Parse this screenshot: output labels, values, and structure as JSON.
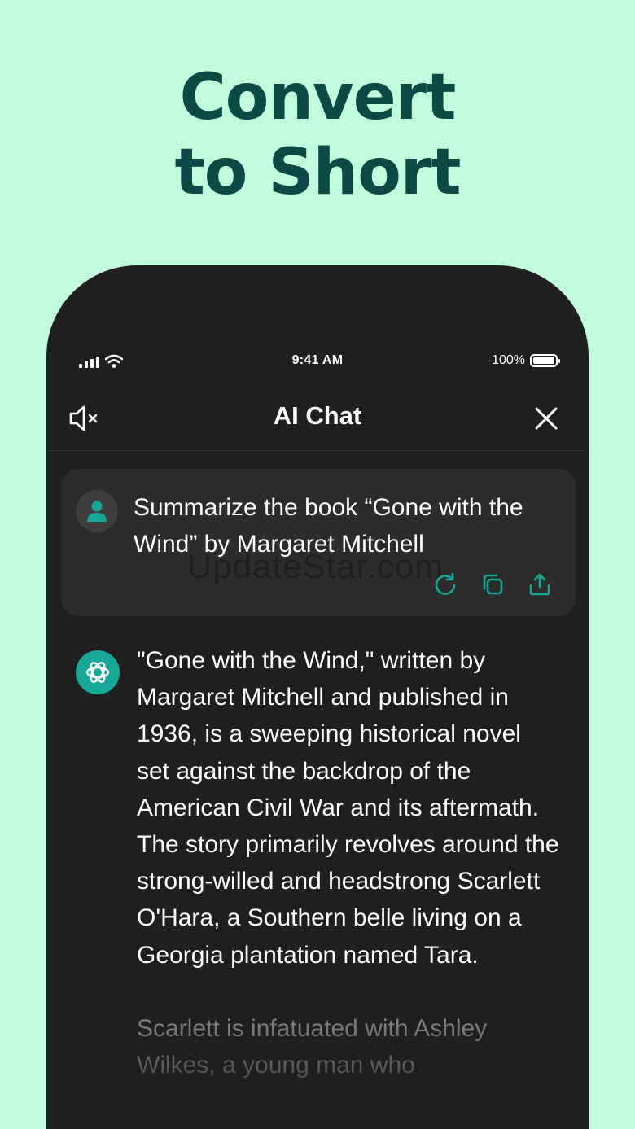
{
  "headline": {
    "line1": "Convert",
    "line2": "to Short"
  },
  "status_bar": {
    "time": "9:41 AM",
    "battery": "100%"
  },
  "nav": {
    "title": "AI Chat"
  },
  "icons": {
    "mute": "speaker-mute-icon",
    "close": "close-icon",
    "user": "user-icon",
    "ai": "openai-logo-icon",
    "regenerate": "refresh-icon",
    "copy": "copy-icon",
    "share": "share-icon"
  },
  "colors": {
    "background": "#c1fcdd",
    "headline": "#0b4a44",
    "accent": "#16a897",
    "phone": "#1f1f1f"
  },
  "user_message": {
    "text": "Summarize the book “Gone with the Wind” by Margaret Mitchell"
  },
  "watermark": "UpdateStar.com",
  "ai_message": {
    "paragraph1": "\"Gone with the Wind,\" written by Margaret Mitchell and published in 1936, is a sweeping historical novel set against the backdrop of the American Civil War and its aftermath. The story primarily revolves around the strong-willed and headstrong Scarlett O'Hara, a Southern belle living on a Georgia plantation named Tara.",
    "paragraph2": "Scarlett is infatuated with Ashley Wilkes, a young man who"
  }
}
